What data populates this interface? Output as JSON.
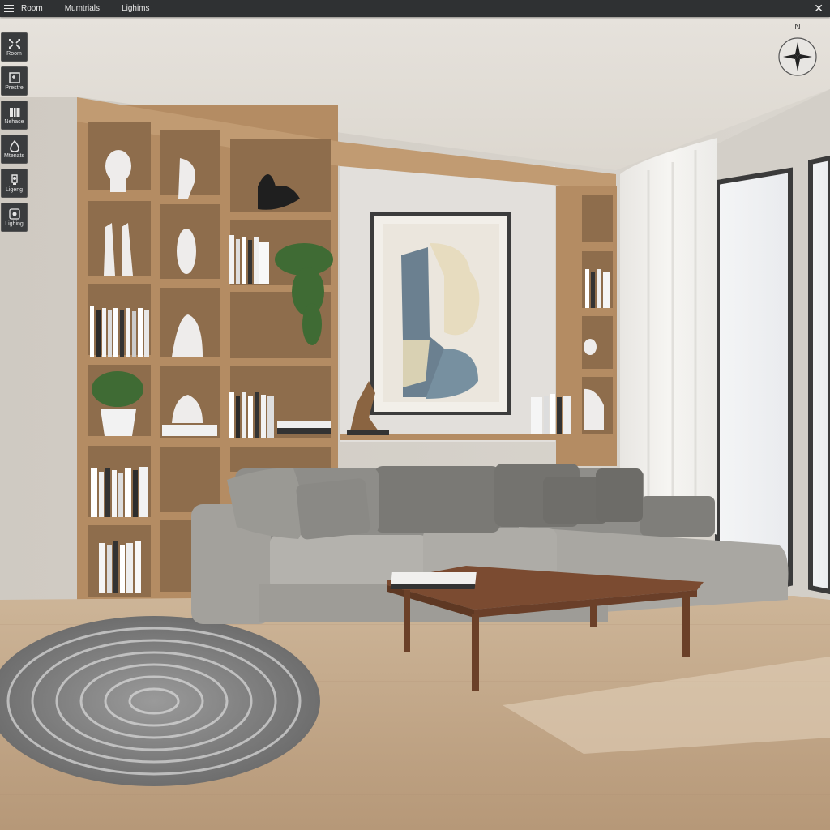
{
  "menu": {
    "items": [
      {
        "label": "Room"
      },
      {
        "label": "Mumtrials"
      },
      {
        "label": "Lighims"
      }
    ]
  },
  "toolbar": {
    "tools": [
      {
        "label": "Room",
        "icon": "move-arrows-icon"
      },
      {
        "label": "Prestre",
        "icon": "frame-icon"
      },
      {
        "label": "Nehace",
        "icon": "furniture-icon"
      },
      {
        "label": "Mtenats",
        "icon": "material-drop-icon"
      },
      {
        "label": "Ligeng",
        "icon": "light-bulb-icon"
      },
      {
        "label": "Lighing",
        "icon": "lighting-icon"
      }
    ]
  },
  "compass": {
    "north_label": "N"
  },
  "colors": {
    "menubar": "#2f3133",
    "wall": "#d8d3cb",
    "wood_shelf": "#b58e66",
    "sofa": "#9a9893",
    "floor": "#c7ad90",
    "coffee_table": "#7a4a30"
  }
}
